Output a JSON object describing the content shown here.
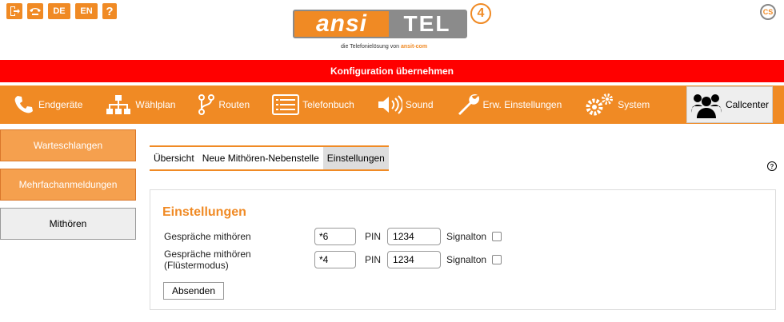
{
  "top_icons": {
    "lang_de": "DE",
    "lang_en": "EN",
    "help": "?"
  },
  "logo": {
    "left": "ansi",
    "right": "TEL",
    "version": "4",
    "tagline_prefix": "die Telefonielösung von",
    "tagline_brand": "ansit-com"
  },
  "cs_icon": "CS",
  "apply_bar": "Konfiguration übernehmen",
  "nav": [
    {
      "label": "Endgeräte",
      "icon": "phone-icon"
    },
    {
      "label": "Wählplan",
      "icon": "sitemap-icon"
    },
    {
      "label": "Routen",
      "icon": "route-icon"
    },
    {
      "label": "Telefonbuch",
      "icon": "list-icon"
    },
    {
      "label": "Sound",
      "icon": "speaker-icon"
    },
    {
      "label": "Erw. Einstellungen",
      "icon": "wrench-icon"
    },
    {
      "label": "System",
      "icon": "gears-icon"
    },
    {
      "label": "Callcenter",
      "icon": "users-icon",
      "active": true
    }
  ],
  "sidebar": [
    {
      "label": "Warteschlangen"
    },
    {
      "label": "Mehrfachanmeldungen"
    },
    {
      "label": "Mithören",
      "active": true
    }
  ],
  "subtabs": [
    {
      "label": "Übersicht"
    },
    {
      "label": "Neue Mithören-Nebenstelle"
    },
    {
      "label": "Einstellungen",
      "active": true
    }
  ],
  "panel": {
    "title": "Einstellungen",
    "rows": [
      {
        "label": "Gespräche mithören",
        "code": "*6",
        "pin_label": "PIN",
        "pin": "1234",
        "signal_label": "Signalton",
        "signal": false
      },
      {
        "label": "Gespräche mithören (Flüstermodus)",
        "code": "*4",
        "pin_label": "PIN",
        "pin": "1234",
        "signal_label": "Signalton",
        "signal": false
      }
    ],
    "submit": "Absenden"
  },
  "help_icon": "?",
  "colors": {
    "accent": "#f08a24",
    "alert": "#ff0000",
    "logo_gray": "#8b8b8b"
  }
}
